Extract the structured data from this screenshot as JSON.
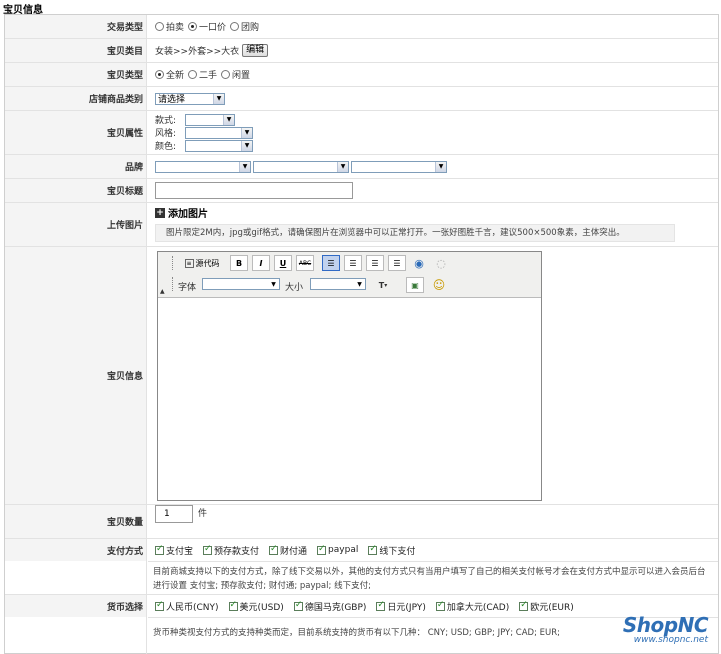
{
  "section_title": "宝贝信息",
  "rows": {
    "trade_type": {
      "label": "交易类型",
      "options": [
        "拍卖",
        "一口价",
        "团购"
      ],
      "selected": 1
    },
    "category": {
      "label": "宝贝类目",
      "value": "女装>>外套>>大衣",
      "edit_label": "编辑"
    },
    "condition": {
      "label": "宝贝类型",
      "options": [
        "全新",
        "二手",
        "闲置"
      ],
      "selected": 0
    },
    "store_category": {
      "label": "店铺商品类别",
      "select_value": "请选择"
    },
    "attributes": {
      "label": "宝贝属性",
      "items": [
        "款式:",
        "风格:",
        "颜色:"
      ]
    },
    "brand": {
      "label": "品牌"
    },
    "title": {
      "label": "宝贝标题",
      "value": ""
    },
    "upload": {
      "label": "上传图片",
      "add_label": "添加图片",
      "hint": "图片限定2M内，jpg或gif格式，请确保图片在浏览器中可以正常打开。一张好图胜千言，建议500×500象素，主体突出。"
    },
    "description": {
      "label": "宝贝信息",
      "source_label": "源代码",
      "font_label": "字体",
      "size_label": "大小"
    },
    "quantity": {
      "label": "宝贝数量",
      "value": "1",
      "unit": "件"
    },
    "payment": {
      "label": "支付方式",
      "options": [
        "支付宝",
        "预存款支付",
        "财付通",
        "paypal",
        "线下支付"
      ],
      "note": "目前商城支持以下的支付方式，除了线下交易以外，其他的支付方式只有当用户填写了自己的相关支付帐号才会在支付方式中显示可以进入会员后台进行设置 支付宝; 预存款支付; 财付通; paypal; 线下支付;"
    },
    "currency": {
      "label": "货币选择",
      "options": [
        "人民币(CNY)",
        "美元(USD)",
        "德国马克(GBP)",
        "日元(JPY)",
        "加拿大元(CAD)",
        "欧元(EUR)"
      ],
      "note": "货币种类视支付方式的支持种类而定，目前系统支持的货币有以下几种： CNY; USD; GBP; JPY; CAD; EUR;"
    }
  },
  "watermark": {
    "logo": "ShopNC",
    "url": "www.shopnc.net"
  }
}
